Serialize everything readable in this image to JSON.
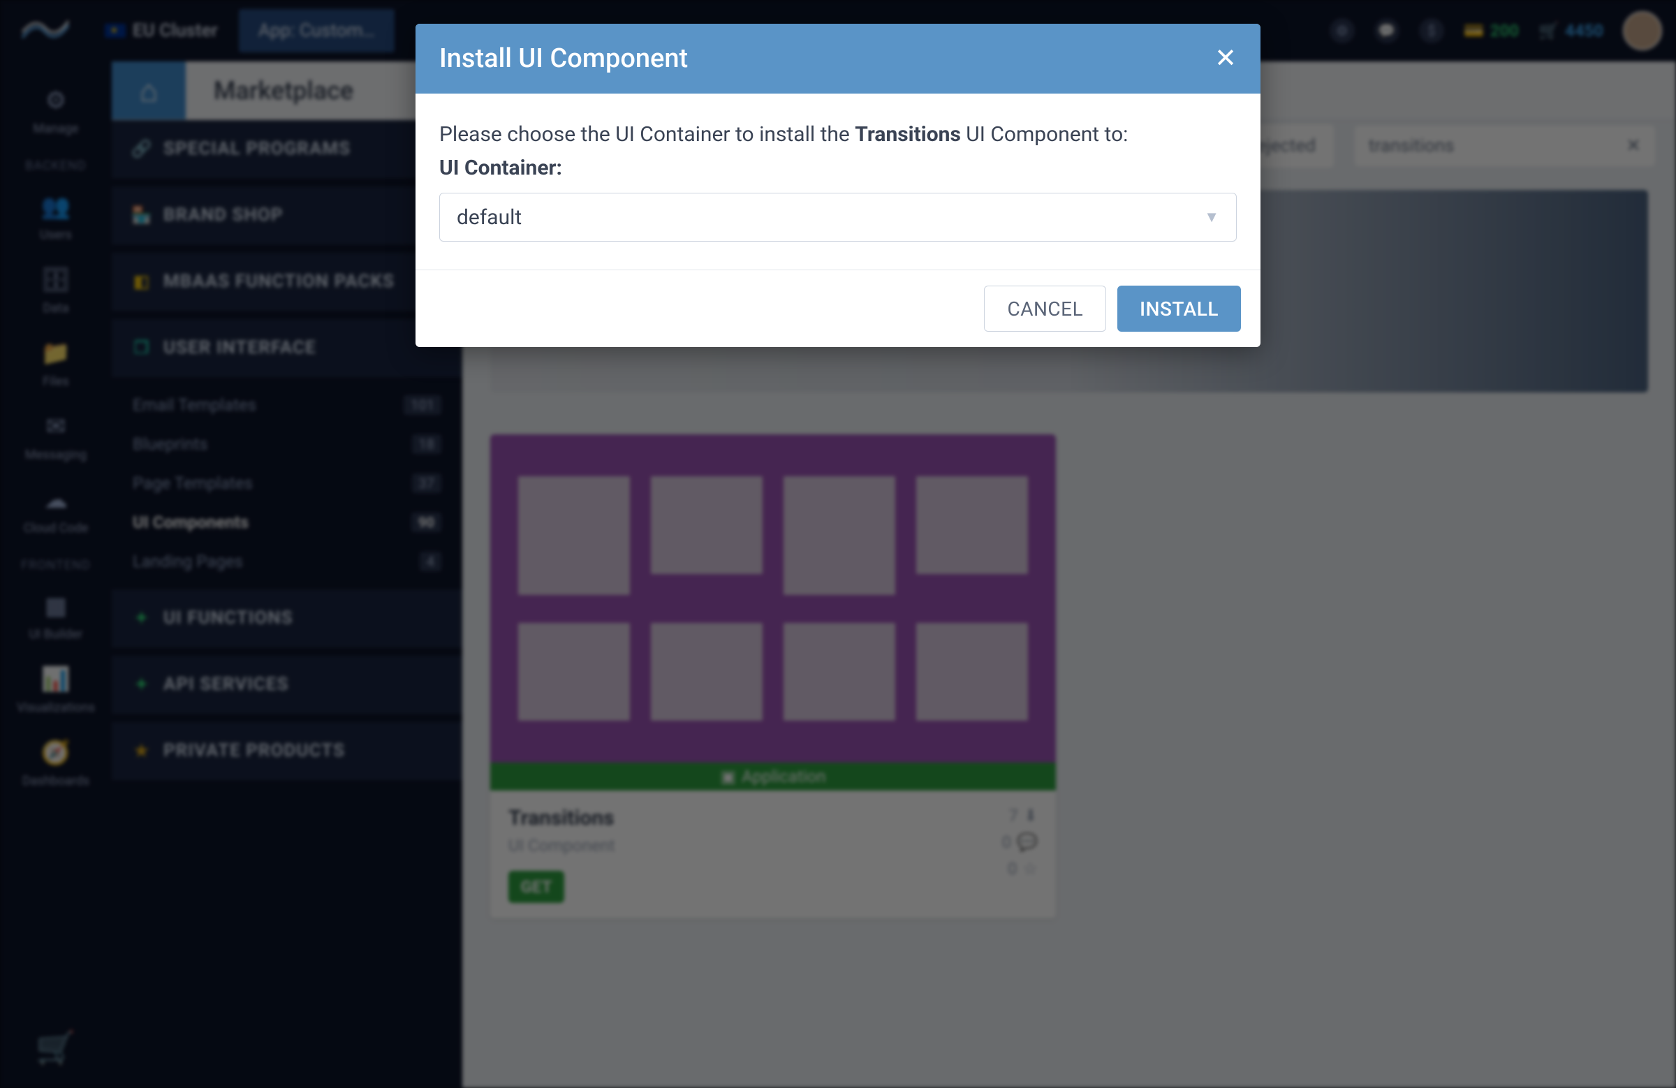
{
  "topbar": {
    "cluster_label": "EU Cluster",
    "tab_label": "App: Custom…",
    "credits_green": "200",
    "credits_blue": "4450"
  },
  "leftbar": {
    "backend_label": "BACKEND",
    "frontend_label": "FRONTEND",
    "items": [
      {
        "label": "Manage"
      },
      {
        "label": "Users"
      },
      {
        "label": "Data"
      },
      {
        "label": "Files"
      },
      {
        "label": "Messaging"
      },
      {
        "label": "Cloud Code"
      },
      {
        "label": "UI Builder"
      },
      {
        "label": "Visualizations"
      },
      {
        "label": "Dashboards"
      }
    ]
  },
  "header": {
    "page_title": "Marketplace"
  },
  "sidebar": {
    "sections": [
      {
        "label": "SPECIAL PROGRAMS"
      },
      {
        "label": "BRAND SHOP"
      },
      {
        "label": "MBAAS FUNCTION PACKS"
      },
      {
        "label": "USER INTERFACE"
      },
      {
        "label": "UI FUNCTIONS"
      },
      {
        "label": "API SERVICES"
      },
      {
        "label": "PRIVATE PRODUCTS"
      }
    ],
    "ui_subitems": [
      {
        "label": "Email Templates",
        "count": "101"
      },
      {
        "label": "Blueprints",
        "count": "18"
      },
      {
        "label": "Page Templates",
        "count": "37"
      },
      {
        "label": "UI Components",
        "count": "90"
      },
      {
        "label": "Landing Pages",
        "count": "4"
      }
    ]
  },
  "filters": {
    "reject_label": "Rejected",
    "search_value": "transitions"
  },
  "card": {
    "bar_label": "Application",
    "title": "Transitions",
    "subtitle": "UI Component",
    "get_label": "GET",
    "stat_downloads": "7",
    "stat_comments": "0",
    "stat_stars": "0"
  },
  "modal": {
    "title": "Install UI Component",
    "prompt_pre": "Please choose the UI Container to install the ",
    "prompt_component": "Transitions",
    "prompt_post": " UI Component to:",
    "field_label": "UI Container:",
    "selected_value": "default",
    "cancel_label": "CANCEL",
    "install_label": "INSTALL"
  }
}
